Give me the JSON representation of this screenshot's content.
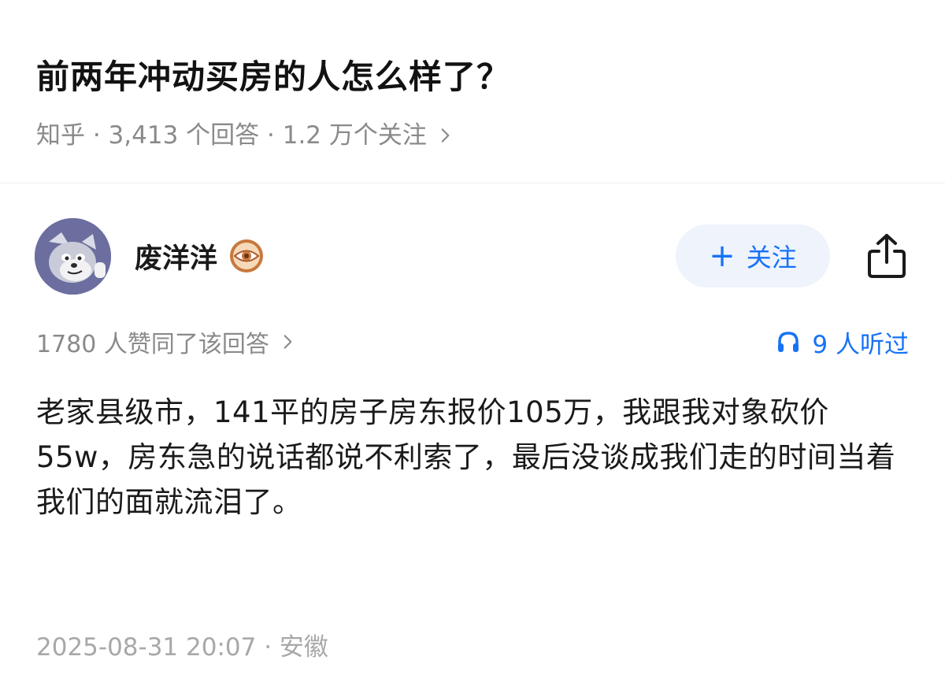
{
  "question": {
    "title": "前两年冲动买房的人怎么样了？",
    "meta": "知乎 · 3,413 个回答 · 1.2 万个关注"
  },
  "author": {
    "name": "废洋洋",
    "badge_icon": "eye-medal-icon",
    "avatar_icon": "cartoon-cat-avatar"
  },
  "actions": {
    "follow_plus": "+",
    "follow_label": "关注",
    "share_icon": "share-icon"
  },
  "stats": {
    "votes": "1780 人赞同了该回答",
    "listeners": "9 人听过"
  },
  "answer": {
    "paragraphs": [
      "老家县级市，141平的房子房东报价105万，我跟我对象砍价55w，房东急的说话都说不利索了，最后没谈成我们走的时间当着我们的面就流泪了。"
    ]
  },
  "footer": {
    "timestamp": "2025-08-31 20:07 · 安徽"
  },
  "colors": {
    "accent": "#1772f6",
    "follow_bg": "#eef3fc",
    "meta_text": "#8a8a8a",
    "badge": "#c8783c"
  }
}
